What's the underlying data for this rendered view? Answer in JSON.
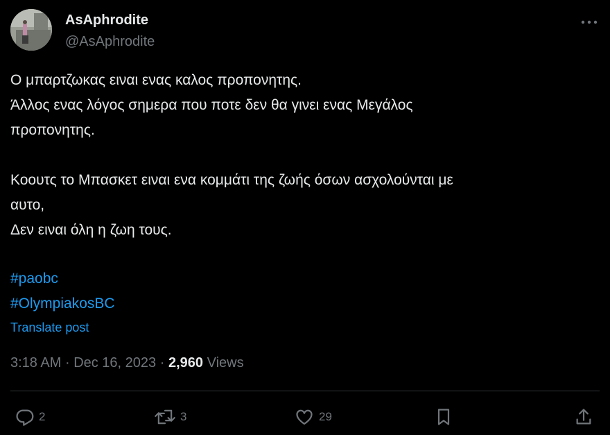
{
  "author": {
    "display_name": "AsAphrodite",
    "handle": "@AsAphrodite"
  },
  "post": {
    "lines": [
      "Ο μπαρτζωκας ειναι ενας καλος προπονητης.",
      "Άλλος ενας λόγος σημερα που ποτε δεν θα γινει ενας Μεγάλος",
      "προπονητης.",
      "Κοουτς το Μπασκετ ειναι ενα κομμάτι της ζωής όσων ασχολούνται με",
      "αυτο,",
      "Δεν ειναι όλη η ζωη τους."
    ],
    "hashtags": [
      "#paobc",
      "#OlympiakosBC"
    ],
    "translate_label": "Translate post"
  },
  "meta": {
    "time": "3:18 AM",
    "separator": "·",
    "date": "Dec 16, 2023",
    "views_count": "2,960",
    "views_label": "Views"
  },
  "actions": {
    "reply": {
      "icon": "reply-icon",
      "count": "2"
    },
    "repost": {
      "icon": "repost-icon",
      "count": "3"
    },
    "like": {
      "icon": "heart-icon",
      "count": "29"
    },
    "bookmark": {
      "icon": "bookmark-icon"
    },
    "share": {
      "icon": "share-icon"
    }
  },
  "colors": {
    "background": "#000000",
    "text": "#e7e9ea",
    "secondary": "#71767b",
    "link": "#1d9bf0",
    "divider": "#2f3336"
  }
}
